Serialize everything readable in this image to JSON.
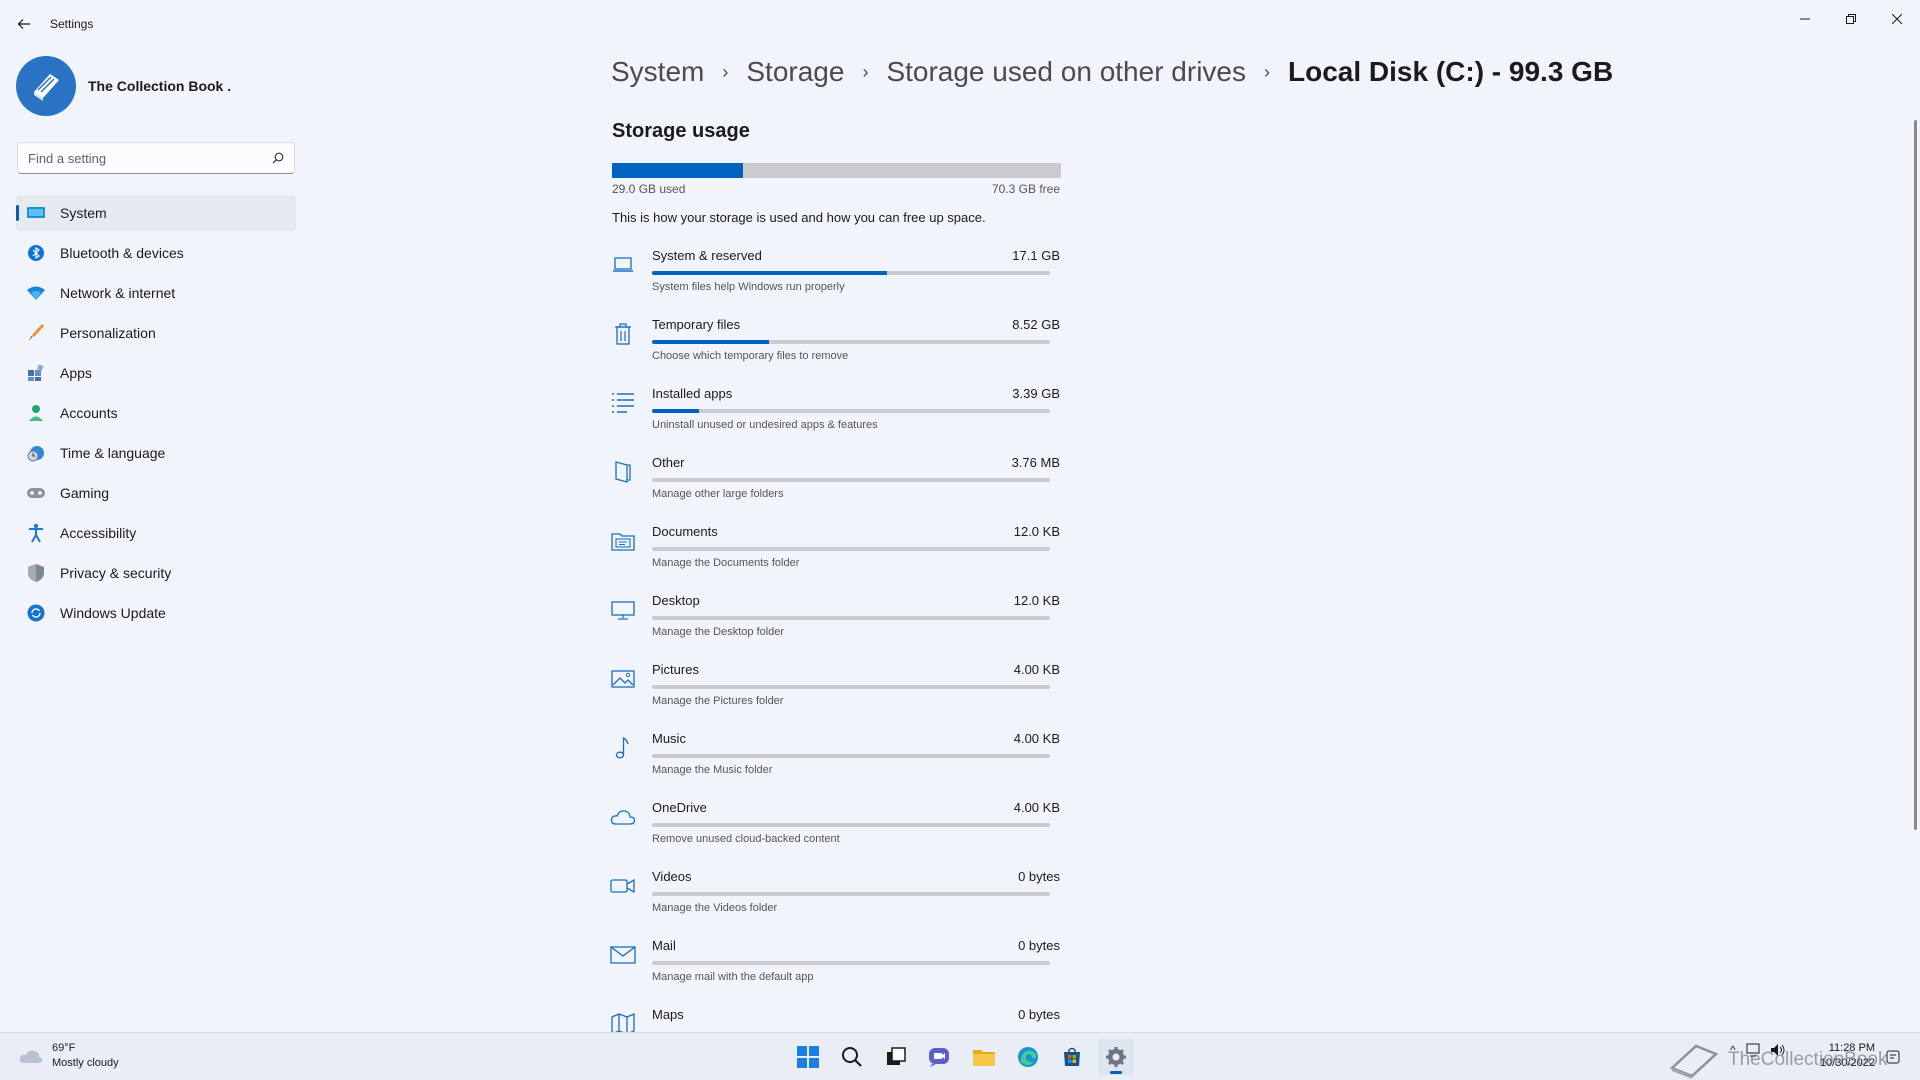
{
  "window": {
    "app_title": "Settings",
    "back_icon": "back-arrow-icon",
    "controls": [
      "minimize-icon",
      "restore-icon",
      "close-icon"
    ]
  },
  "profile": {
    "name": "The Collection Book ."
  },
  "search": {
    "placeholder": "Find a setting"
  },
  "sidebar": {
    "items": [
      {
        "label": "System",
        "icon": "system-icon",
        "active": true
      },
      {
        "label": "Bluetooth & devices",
        "icon": "bluetooth-icon"
      },
      {
        "label": "Network & internet",
        "icon": "wifi-icon"
      },
      {
        "label": "Personalization",
        "icon": "brush-icon"
      },
      {
        "label": "Apps",
        "icon": "apps-icon"
      },
      {
        "label": "Accounts",
        "icon": "account-icon"
      },
      {
        "label": "Time & language",
        "icon": "clock-globe-icon"
      },
      {
        "label": "Gaming",
        "icon": "gamepad-icon"
      },
      {
        "label": "Accessibility",
        "icon": "accessibility-icon"
      },
      {
        "label": "Privacy & security",
        "icon": "shield-icon"
      },
      {
        "label": "Windows Update",
        "icon": "update-icon"
      }
    ]
  },
  "breadcrumb": {
    "items": [
      "System",
      "Storage",
      "Storage used on other drives",
      "Local Disk (C:) - 99.3 GB"
    ]
  },
  "storage": {
    "title": "Storage usage",
    "used_label": "29.0 GB used",
    "free_label": "70.3 GB free",
    "used_fraction": 0.292,
    "description": "This is how your storage is used and how you can free up space.",
    "categories": [
      {
        "name": "System & reserved",
        "size": "17.1 GB",
        "sub": "System files help Windows run properly",
        "fraction": 0.59,
        "icon": "laptop-icon"
      },
      {
        "name": "Temporary files",
        "size": "8.52 GB",
        "sub": "Choose which temporary files to remove",
        "fraction": 0.294,
        "icon": "trash-icon"
      },
      {
        "name": "Installed apps",
        "size": "3.39 GB",
        "sub": "Uninstall unused or undesired apps & features",
        "fraction": 0.117,
        "icon": "list-icon"
      },
      {
        "name": "Other",
        "size": "3.76 MB",
        "sub": "Manage other large folders",
        "fraction": 0,
        "icon": "folder-book-icon"
      },
      {
        "name": "Documents",
        "size": "12.0 KB",
        "sub": "Manage the Documents folder",
        "fraction": 0,
        "icon": "documents-icon"
      },
      {
        "name": "Desktop",
        "size": "12.0 KB",
        "sub": "Manage the Desktop folder",
        "fraction": 0,
        "icon": "monitor-icon"
      },
      {
        "name": "Pictures",
        "size": "4.00 KB",
        "sub": "Manage the Pictures folder",
        "fraction": 0,
        "icon": "picture-icon"
      },
      {
        "name": "Music",
        "size": "4.00 KB",
        "sub": "Manage the Music folder",
        "fraction": 0,
        "icon": "music-note-icon"
      },
      {
        "name": "OneDrive",
        "size": "4.00 KB",
        "sub": "Remove unused cloud-backed content",
        "fraction": 0,
        "icon": "cloud-icon"
      },
      {
        "name": "Videos",
        "size": "0 bytes",
        "sub": "Manage the Videos folder",
        "fraction": 0,
        "icon": "video-camera-icon"
      },
      {
        "name": "Mail",
        "size": "0 bytes",
        "sub": "Manage mail with the default app",
        "fraction": 0,
        "icon": "mail-icon"
      },
      {
        "name": "Maps",
        "size": "0 bytes",
        "sub": "",
        "fraction": 0,
        "icon": "map-icon"
      }
    ]
  },
  "taskbar": {
    "weather_temp": "69°F",
    "weather_desc": "Mostly cloudy",
    "apps": [
      "windows-start-icon",
      "search-icon",
      "task-view-icon",
      "chat-icon",
      "file-explorer-icon",
      "edge-icon",
      "store-icon",
      "settings-gear-icon"
    ],
    "clock_time": "11:28 PM",
    "clock_date": "10/30/2022",
    "watermark": "TheCollectionBook"
  },
  "colors": {
    "accent": "#005fb8",
    "bar_fill": "#0063c1",
    "bar_track": "#c9cbcf"
  }
}
